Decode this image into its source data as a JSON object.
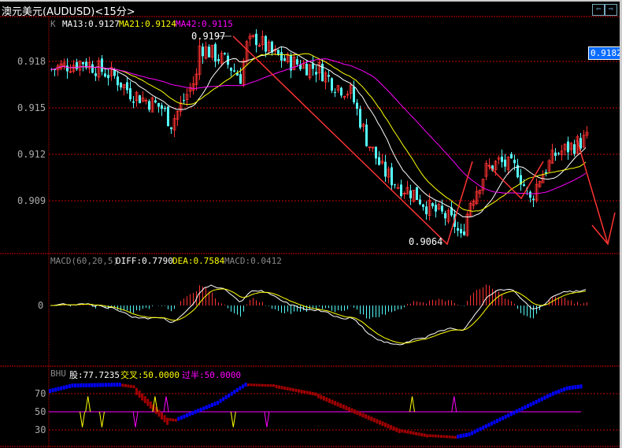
{
  "window": {
    "title": "澳元美元(AUDUSD)<15分>",
    "nav_left": "⇦",
    "nav_right": "⇨"
  },
  "main_panel": {
    "legend": {
      "k": "K",
      "ma13": "MA13:0.9127",
      "ma21": "MA21:0.9124",
      "ma42": "MA42:0.9115"
    },
    "high_label": "0.9197",
    "low_label": "0.9064",
    "price_tag": "0.9182",
    "y_ticks": [
      "0.918",
      "0.915",
      "0.912",
      "0.909"
    ]
  },
  "macd_panel": {
    "legend": {
      "name": "MACD(60,20,5)",
      "diff": "DIFF:0.7790",
      "dea": "DEA:0.7584",
      "macd": "MACD:0.0412"
    },
    "y_ticks": [
      "0"
    ]
  },
  "bhu_panel": {
    "legend": {
      "name": "BHU",
      "gu": "股:77.7235",
      "jiaocha": "交叉:50.0000",
      "guoban": "过半:50.0000"
    },
    "y_ticks": [
      "70",
      "50",
      "30"
    ]
  },
  "colors": {
    "up": "#ff3232",
    "down": "#54fcfc",
    "ma13": "#ffffff",
    "ma21": "#ffff00",
    "ma42": "#ff00ff",
    "grid": "#c80000",
    "bhu_up": "#0000ff",
    "bhu_down": "#a00000"
  },
  "chart_data": {
    "type": "candlestick",
    "price_range": [
      0.9055,
      0.9205
    ],
    "close_keypoints": [
      [
        0,
        0.9175
      ],
      [
        10,
        0.918
      ],
      [
        20,
        0.917
      ],
      [
        25,
        0.916
      ],
      [
        35,
        0.915
      ],
      [
        38,
        0.914
      ],
      [
        42,
        0.9155
      ],
      [
        46,
        0.917
      ],
      [
        47,
        0.919
      ],
      [
        55,
        0.918
      ],
      [
        60,
        0.917
      ],
      [
        62,
        0.919
      ],
      [
        65,
        0.9195
      ],
      [
        70,
        0.9185
      ],
      [
        75,
        0.918
      ],
      [
        85,
        0.9175
      ],
      [
        90,
        0.9165
      ],
      [
        95,
        0.916
      ],
      [
        100,
        0.913
      ],
      [
        105,
        0.911
      ],
      [
        110,
        0.91
      ],
      [
        115,
        0.9095
      ],
      [
        120,
        0.9085
      ],
      [
        125,
        0.908
      ],
      [
        128,
        0.9075
      ],
      [
        130,
        0.9065
      ],
      [
        133,
        0.909
      ],
      [
        138,
        0.911
      ],
      [
        142,
        0.9115
      ],
      [
        148,
        0.911
      ],
      [
        150,
        0.91
      ],
      [
        152,
        0.909
      ],
      [
        155,
        0.9105
      ],
      [
        160,
        0.912
      ],
      [
        165,
        0.9125
      ],
      [
        170,
        0.913
      ]
    ],
    "bhu_keypoints": [
      [
        0,
        73
      ],
      [
        8,
        79
      ],
      [
        25,
        80
      ],
      [
        30,
        78
      ],
      [
        42,
        42
      ],
      [
        45,
        41
      ],
      [
        60,
        60
      ],
      [
        70,
        80
      ],
      [
        80,
        79
      ],
      [
        95,
        70
      ],
      [
        110,
        50
      ],
      [
        125,
        30
      ],
      [
        135,
        24
      ],
      [
        145,
        22
      ],
      [
        150,
        25
      ],
      [
        160,
        40
      ],
      [
        170,
        55
      ],
      [
        180,
        70
      ],
      [
        185,
        76
      ],
      [
        190,
        78
      ]
    ],
    "bhu_signals": [
      [
        14,
        "up",
        "jiaocha"
      ],
      [
        12,
        "down",
        "jiaocha"
      ],
      [
        19,
        "down",
        "jiaocha"
      ],
      [
        31,
        "down",
        "guoban"
      ],
      [
        38,
        "up",
        "jiaocha"
      ],
      [
        42,
        "up",
        "guoban"
      ],
      [
        66,
        "down",
        "jiaocha"
      ],
      [
        78,
        "down",
        "guoban"
      ],
      [
        130,
        "up",
        "jiaocha"
      ],
      [
        145,
        "up",
        "guoban"
      ]
    ]
  }
}
